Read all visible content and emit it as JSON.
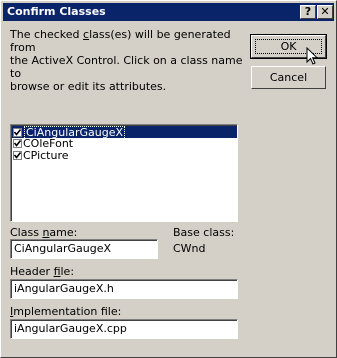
{
  "window": {
    "title": "Confirm Classes",
    "help_glyph": "?",
    "close_glyph": "✕"
  },
  "description": {
    "part1": "The checked ",
    "part2_underlined": "c",
    "part3": "lass(es) will be generated from\nthe ActiveX Control.  Click on a class name to\nbrowse or edit its attributes."
  },
  "buttons": {
    "ok": "OK",
    "cancel": "Cancel"
  },
  "class_list": {
    "items": [
      {
        "label": "CiAngularGaugeX",
        "checked": true,
        "selected": true
      },
      {
        "label": "COleFont",
        "checked": true,
        "selected": false
      },
      {
        "label": "CPicture",
        "checked": true,
        "selected": false
      }
    ]
  },
  "class_name": {
    "label_pre": "Class ",
    "label_u": "n",
    "label_post": "ame:",
    "value": "CiAngularGaugeX"
  },
  "base_class": {
    "label": "Base class:",
    "value": "CWnd"
  },
  "header_file": {
    "label_pre": "Header ",
    "label_u": "f",
    "label_post": "ile:",
    "value": "iAngularGaugeX.h"
  },
  "implementation_file": {
    "label_pre": "",
    "label_u": "I",
    "label_post": "mplementation file:",
    "value": "iAngularGaugeX.cpp"
  },
  "colors": {
    "face": "#d4d0c8",
    "titlebar": "#0a246a",
    "selection": "#0a246a"
  }
}
